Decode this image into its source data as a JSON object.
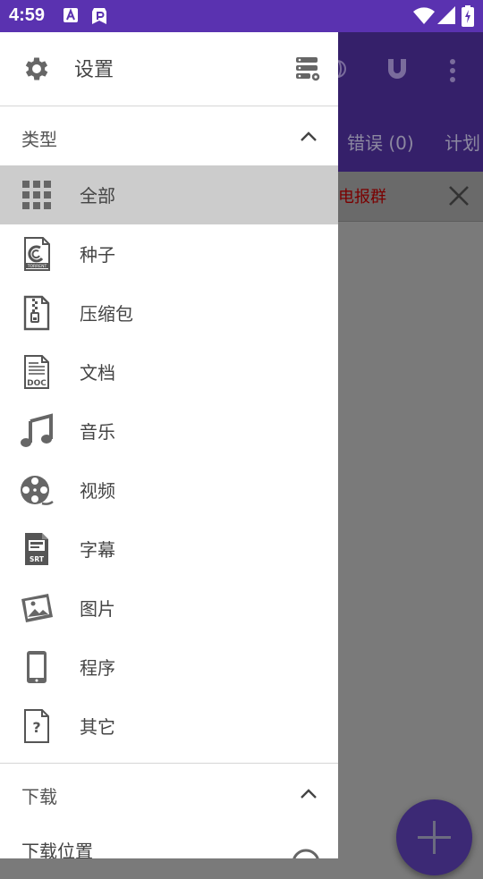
{
  "status_bar": {
    "time": "4:59"
  },
  "background": {
    "tabs": [
      "错误 (0)",
      "计划"
    ],
    "notice_text": "电报群"
  },
  "drawer": {
    "header": {
      "title": "设置"
    },
    "type_section": {
      "label": "类型"
    },
    "items": [
      {
        "label": "全部",
        "icon": "grid-icon",
        "selected": true
      },
      {
        "label": "种子",
        "icon": "torrent-file-icon"
      },
      {
        "label": "压缩包",
        "icon": "zip-file-icon"
      },
      {
        "label": "文档",
        "icon": "doc-file-icon"
      },
      {
        "label": "音乐",
        "icon": "music-note-icon"
      },
      {
        "label": "视频",
        "icon": "film-reel-icon"
      },
      {
        "label": "字幕",
        "icon": "srt-file-icon"
      },
      {
        "label": "图片",
        "icon": "image-icon"
      },
      {
        "label": "程序",
        "icon": "phone-icon"
      },
      {
        "label": "其它",
        "icon": "unknown-file-icon"
      }
    ],
    "download_section": {
      "label": "下载"
    },
    "download_location": {
      "label": "下载位置"
    }
  },
  "colors": {
    "status_bar": "#5a32b0",
    "toolbar_dimmed": "#35206a",
    "fab_dimmed": "#3c2975",
    "selected_item": "#cccccc"
  }
}
